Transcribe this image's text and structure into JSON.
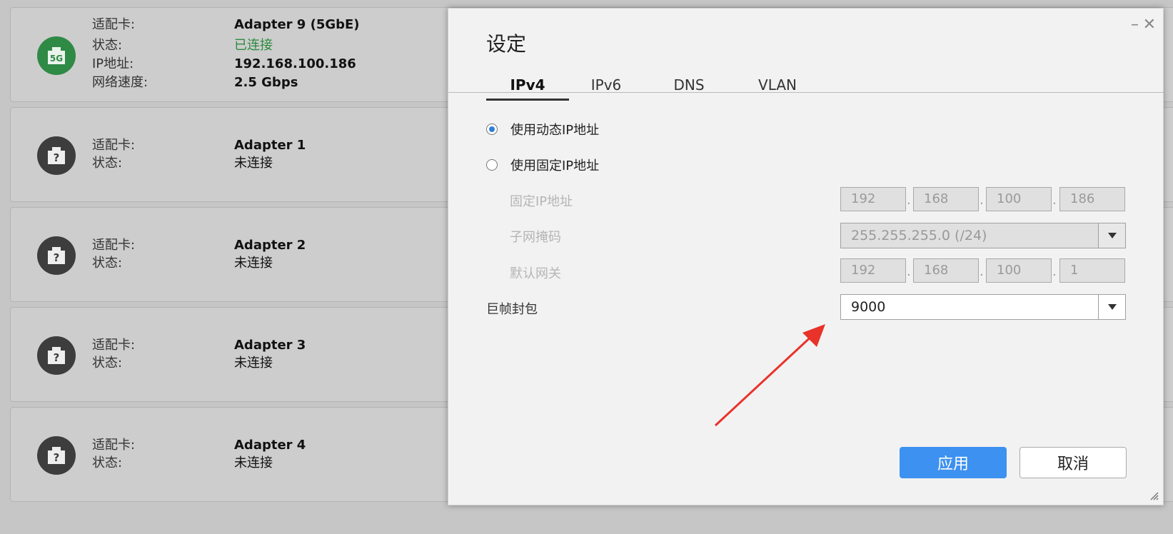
{
  "cards": [
    {
      "icon": "5g-network-icon",
      "icon_text": "5G",
      "labels": [
        "适配卡:",
        "状态:",
        "IP地址:",
        "网络速度:"
      ],
      "values": [
        "Adapter 9 (5GbE)",
        "已连接",
        "192.168.100.186",
        "2.5 Gbps"
      ]
    },
    {
      "icon": "unknown-network-icon",
      "icon_text": "?",
      "labels": [
        "适配卡:",
        "状态:"
      ],
      "values": [
        "Adapter 1",
        "未连接"
      ]
    },
    {
      "icon": "unknown-network-icon",
      "icon_text": "?",
      "labels": [
        "适配卡:",
        "状态:"
      ],
      "values": [
        "Adapter 2",
        "未连接"
      ]
    },
    {
      "icon": "unknown-network-icon",
      "icon_text": "?",
      "labels": [
        "适配卡:",
        "状态:"
      ],
      "values": [
        "Adapter 3",
        "未连接"
      ]
    },
    {
      "icon": "unknown-network-icon",
      "icon_text": "?",
      "labels": [
        "适配卡:",
        "状态:"
      ],
      "values": [
        "Adapter 4",
        "未连接"
      ]
    }
  ],
  "dialog": {
    "title": "设定",
    "minimize": "–",
    "close": "✕",
    "tabs": [
      "IPv4",
      "IPv6",
      "DNS",
      "VLAN"
    ],
    "active_tab": "IPv4",
    "radio_dynamic": "使用动态IP地址",
    "radio_static": "使用固定IP地址",
    "static_ip_label": "固定IP地址",
    "static_ip": [
      "192",
      "168",
      "100",
      "186"
    ],
    "subnet_label": "子网掩码",
    "subnet_value": "255.255.255.0 (/24)",
    "gateway_label": "默认网关",
    "gateway": [
      "192",
      "168",
      "100",
      "1"
    ],
    "jumbo_label": "巨帧封包",
    "jumbo_value": "9000",
    "apply": "应用",
    "cancel": "取消"
  },
  "colors": {
    "accent": "#3d91f0",
    "connected": "#2c8a3f",
    "annotation_arrow": "#e8322a"
  }
}
